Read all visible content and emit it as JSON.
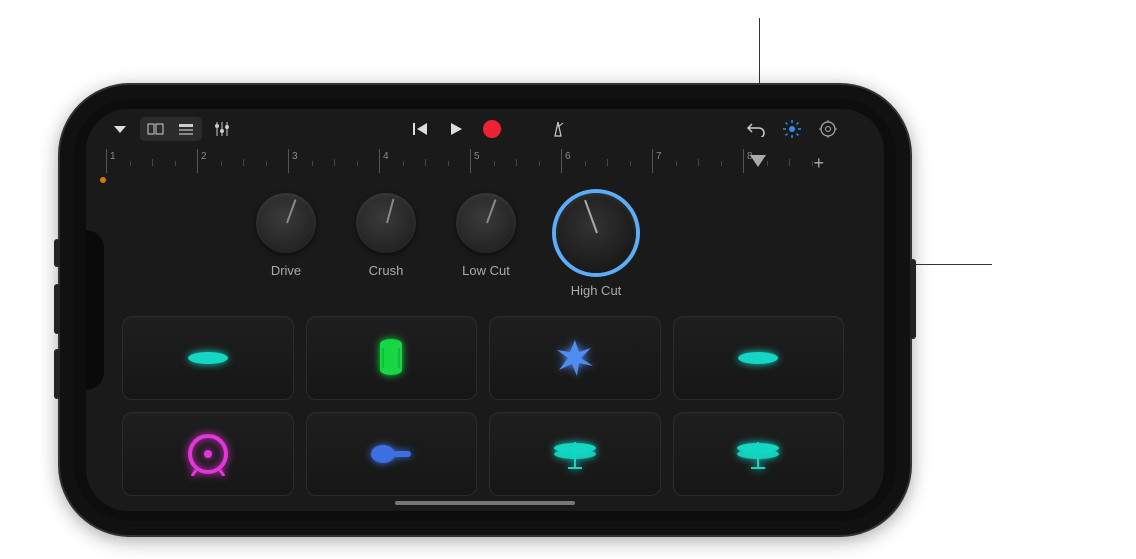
{
  "toolbar": {
    "browser_icon": "browser",
    "view_cells": "cells-view",
    "view_list": "list-view",
    "mixer": "mixer",
    "prev": "previous",
    "play": "play",
    "record": "record",
    "metronome": "metronome",
    "undo": "undo",
    "track_controls": "track-controls",
    "settings": "settings"
  },
  "ruler": {
    "bars": [
      "1",
      "2",
      "3",
      "4",
      "5",
      "6",
      "7",
      "8"
    ],
    "add": "+"
  },
  "knobs": [
    {
      "label": "Drive",
      "angle": 200,
      "big": false
    },
    {
      "label": "Crush",
      "angle": 195,
      "big": false
    },
    {
      "label": "Low Cut",
      "angle": 200,
      "big": false
    },
    {
      "label": "High Cut",
      "angle": 160,
      "big": true
    }
  ],
  "pads": {
    "row1": [
      {
        "name": "cymbal-pad",
        "color": "#14d6c4",
        "shape": "cymbal"
      },
      {
        "name": "drum-pad",
        "color": "#17d744",
        "shape": "tallDrum"
      },
      {
        "name": "clap-pad",
        "color": "#4f8df2",
        "shape": "burst"
      },
      {
        "name": "cymbal-pad-2",
        "color": "#14d6c4",
        "shape": "cymbal"
      }
    ],
    "row2": [
      {
        "name": "kick-pad",
        "color": "#e535d8",
        "shape": "kick"
      },
      {
        "name": "shaker-pad",
        "color": "#3c6fe0",
        "shape": "shaker"
      },
      {
        "name": "hihat-pad-1",
        "color": "#14d6c4",
        "shape": "hihat"
      },
      {
        "name": "hihat-pad-2",
        "color": "#14d6c4",
        "shape": "hihat"
      }
    ]
  }
}
